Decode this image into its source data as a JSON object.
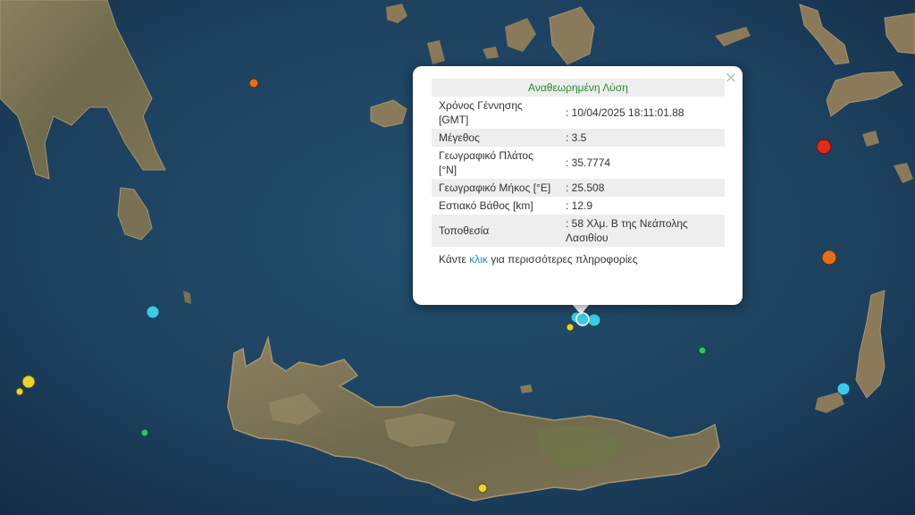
{
  "popup": {
    "title": "Αναθεωρημένη Λύση",
    "close_symbol": "×",
    "rows": [
      {
        "label": "Χρόνος Γέννησης [GMT]",
        "value": ": 10/04/2025 18:11:01.88"
      },
      {
        "label": "Μέγεθος",
        "value": ": 3.5"
      },
      {
        "label": "Γεωγραφικό Πλάτος [°N]",
        "value": ": 35.7774"
      },
      {
        "label": "Γεωγραφικό Μήκος [°E]",
        "value": ": 25.508"
      },
      {
        "label": "Εστιακό Βάθος [km]",
        "value": ": 12.9"
      },
      {
        "label": "Τοποθεσία",
        "value": ": 58 Χλμ. Β της Νεάπολης Λασιθίου"
      }
    ],
    "footer_before": "Κάντε ",
    "footer_link": "κλικ",
    "footer_after": " για περισσότερες πληροφορίες"
  },
  "colors": {
    "sea": "#1d3f5c",
    "land": "#7a7055",
    "title_green": "#2a8a2a",
    "link_blue": "#1a8fc2",
    "marker_cyan": "#3ccbe8",
    "marker_yellow": "#e8d23c",
    "marker_orange": "#e0701e",
    "marker_red": "#e02a1e",
    "marker_green": "#2ec466"
  }
}
